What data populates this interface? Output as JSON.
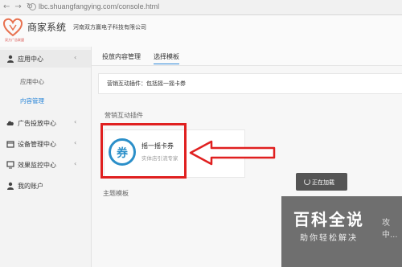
{
  "browser": {
    "url": "lbc.shuangfangying.com/console.html",
    "nav_icons": [
      "back-icon",
      "forward-icon",
      "reload-icon"
    ]
  },
  "header": {
    "logo_caption": "双方广告联盟",
    "system_title": "商家系统",
    "company": "河南双方赢电子科技有限公司"
  },
  "sidebar": {
    "items": [
      {
        "label": "应用中心",
        "icon": "user-icon"
      },
      {
        "label": "广告投放中心",
        "icon": "cloud-icon"
      },
      {
        "label": "设备管理中心",
        "icon": "calendar-icon"
      },
      {
        "label": "效果监控中心",
        "icon": "monitor-icon"
      },
      {
        "label": "我的账户",
        "icon": "person-icon"
      }
    ],
    "sub_items": [
      {
        "label": "应用中心"
      },
      {
        "label": "内容管理",
        "active": true
      }
    ]
  },
  "main": {
    "tabs": [
      {
        "label": "投放内容管理"
      },
      {
        "label": "选择模板",
        "active": true
      }
    ],
    "plugin_bar": "营销互动插件：包括摇一摇卡券",
    "section_plugins": "营销互动插件",
    "card": {
      "icon_text": "券",
      "title": "摇一摇卡券",
      "subtitle": "实体店引流专家"
    },
    "section_theme": "主题模板",
    "loading": "正在加载",
    "overlay_text": "攻中..."
  },
  "watermark": {
    "title": "百科全说",
    "subtitle": "助你轻松解决"
  },
  "colors": {
    "accent": "#2a86d8",
    "highlight": "#e02020",
    "icon_blue": "#2b8fc9"
  }
}
